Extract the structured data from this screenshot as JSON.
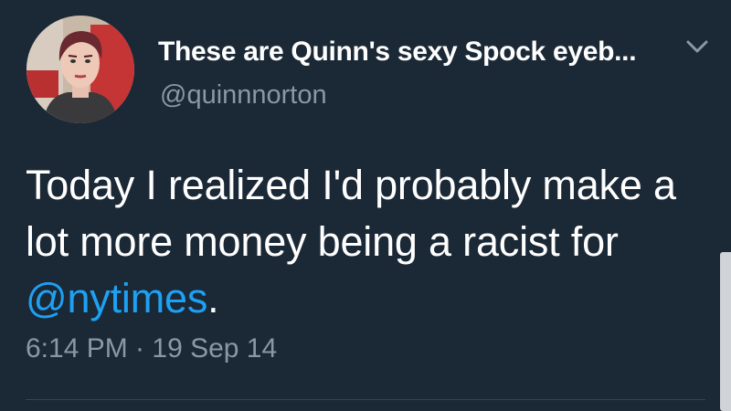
{
  "author": {
    "display_name": "These are Quinn's sexy Spock eyeb...",
    "handle": "@quinnnorton",
    "avatar_icon": "profile-photo"
  },
  "header": {
    "menu_icon": "chevron-down-icon"
  },
  "tweet": {
    "text_before": "Today I realized I'd probably make a lot more money being a racist for ",
    "mention": "@nytimes",
    "text_after": ".",
    "timestamp": "6:14 PM · 19 Sep 14"
  },
  "colors": {
    "background": "#1b2836",
    "text": "#ffffff",
    "secondary": "#8899a6",
    "link": "#1da1f2"
  }
}
